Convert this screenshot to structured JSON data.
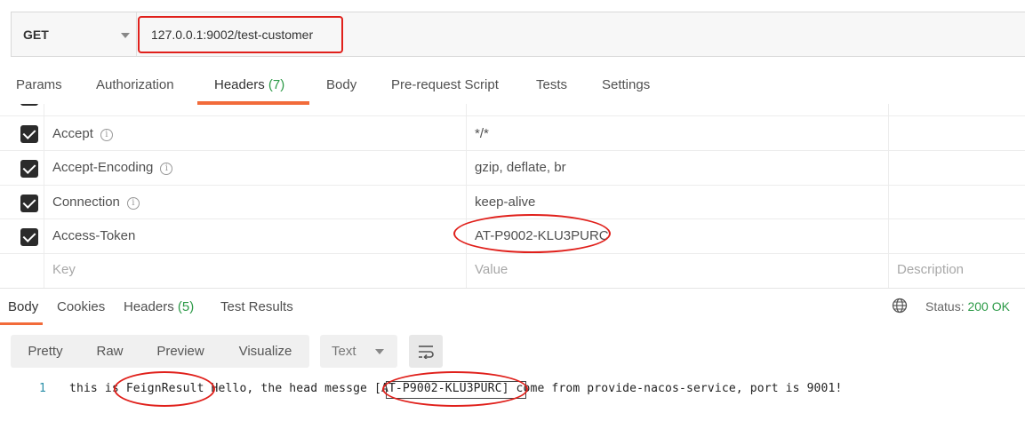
{
  "request": {
    "method": "GET",
    "url": "127.0.0.1:9002/test-customer"
  },
  "request_tabs": [
    {
      "label": "Params",
      "count": ""
    },
    {
      "label": "Authorization",
      "count": ""
    },
    {
      "label": "Headers",
      "count": "(7)"
    },
    {
      "label": "Body",
      "count": ""
    },
    {
      "label": "Pre-request Script",
      "count": ""
    },
    {
      "label": "Tests",
      "count": ""
    },
    {
      "label": "Settings",
      "count": ""
    }
  ],
  "headers": {
    "rows": [
      {
        "key": "Accept",
        "value": "*/*"
      },
      {
        "key": "Accept-Encoding",
        "value": "gzip, deflate, br"
      },
      {
        "key": "Connection",
        "value": "keep-alive"
      },
      {
        "key": "Access-Token",
        "value": "AT-P9002-KLU3PURC"
      }
    ],
    "placeholder": {
      "key": "Key",
      "value": "Value",
      "description": "Description"
    }
  },
  "response_tabs": [
    {
      "label": "Body",
      "count": ""
    },
    {
      "label": "Cookies",
      "count": ""
    },
    {
      "label": "Headers",
      "count": "(5)"
    },
    {
      "label": "Test Results",
      "count": ""
    }
  ],
  "status": {
    "label": "Status:",
    "value": "200 OK"
  },
  "view_modes": [
    "Pretty",
    "Raw",
    "Preview",
    "Visualize"
  ],
  "format": "Text",
  "response_body": {
    "line_number": "1",
    "text": "this is FeignResult Hello, the head messge [AT-P9002-KLU3PURC] come from provide-nacos-service, port is 9001!"
  },
  "colors": {
    "accent": "#f26b3a",
    "success": "#2c9a47",
    "annotation": "#e0201b"
  },
  "icons": [
    "dropdown-caret-icon",
    "info-icon",
    "checkbox-checked-icon",
    "globe-icon",
    "wrap-lines-icon"
  ]
}
